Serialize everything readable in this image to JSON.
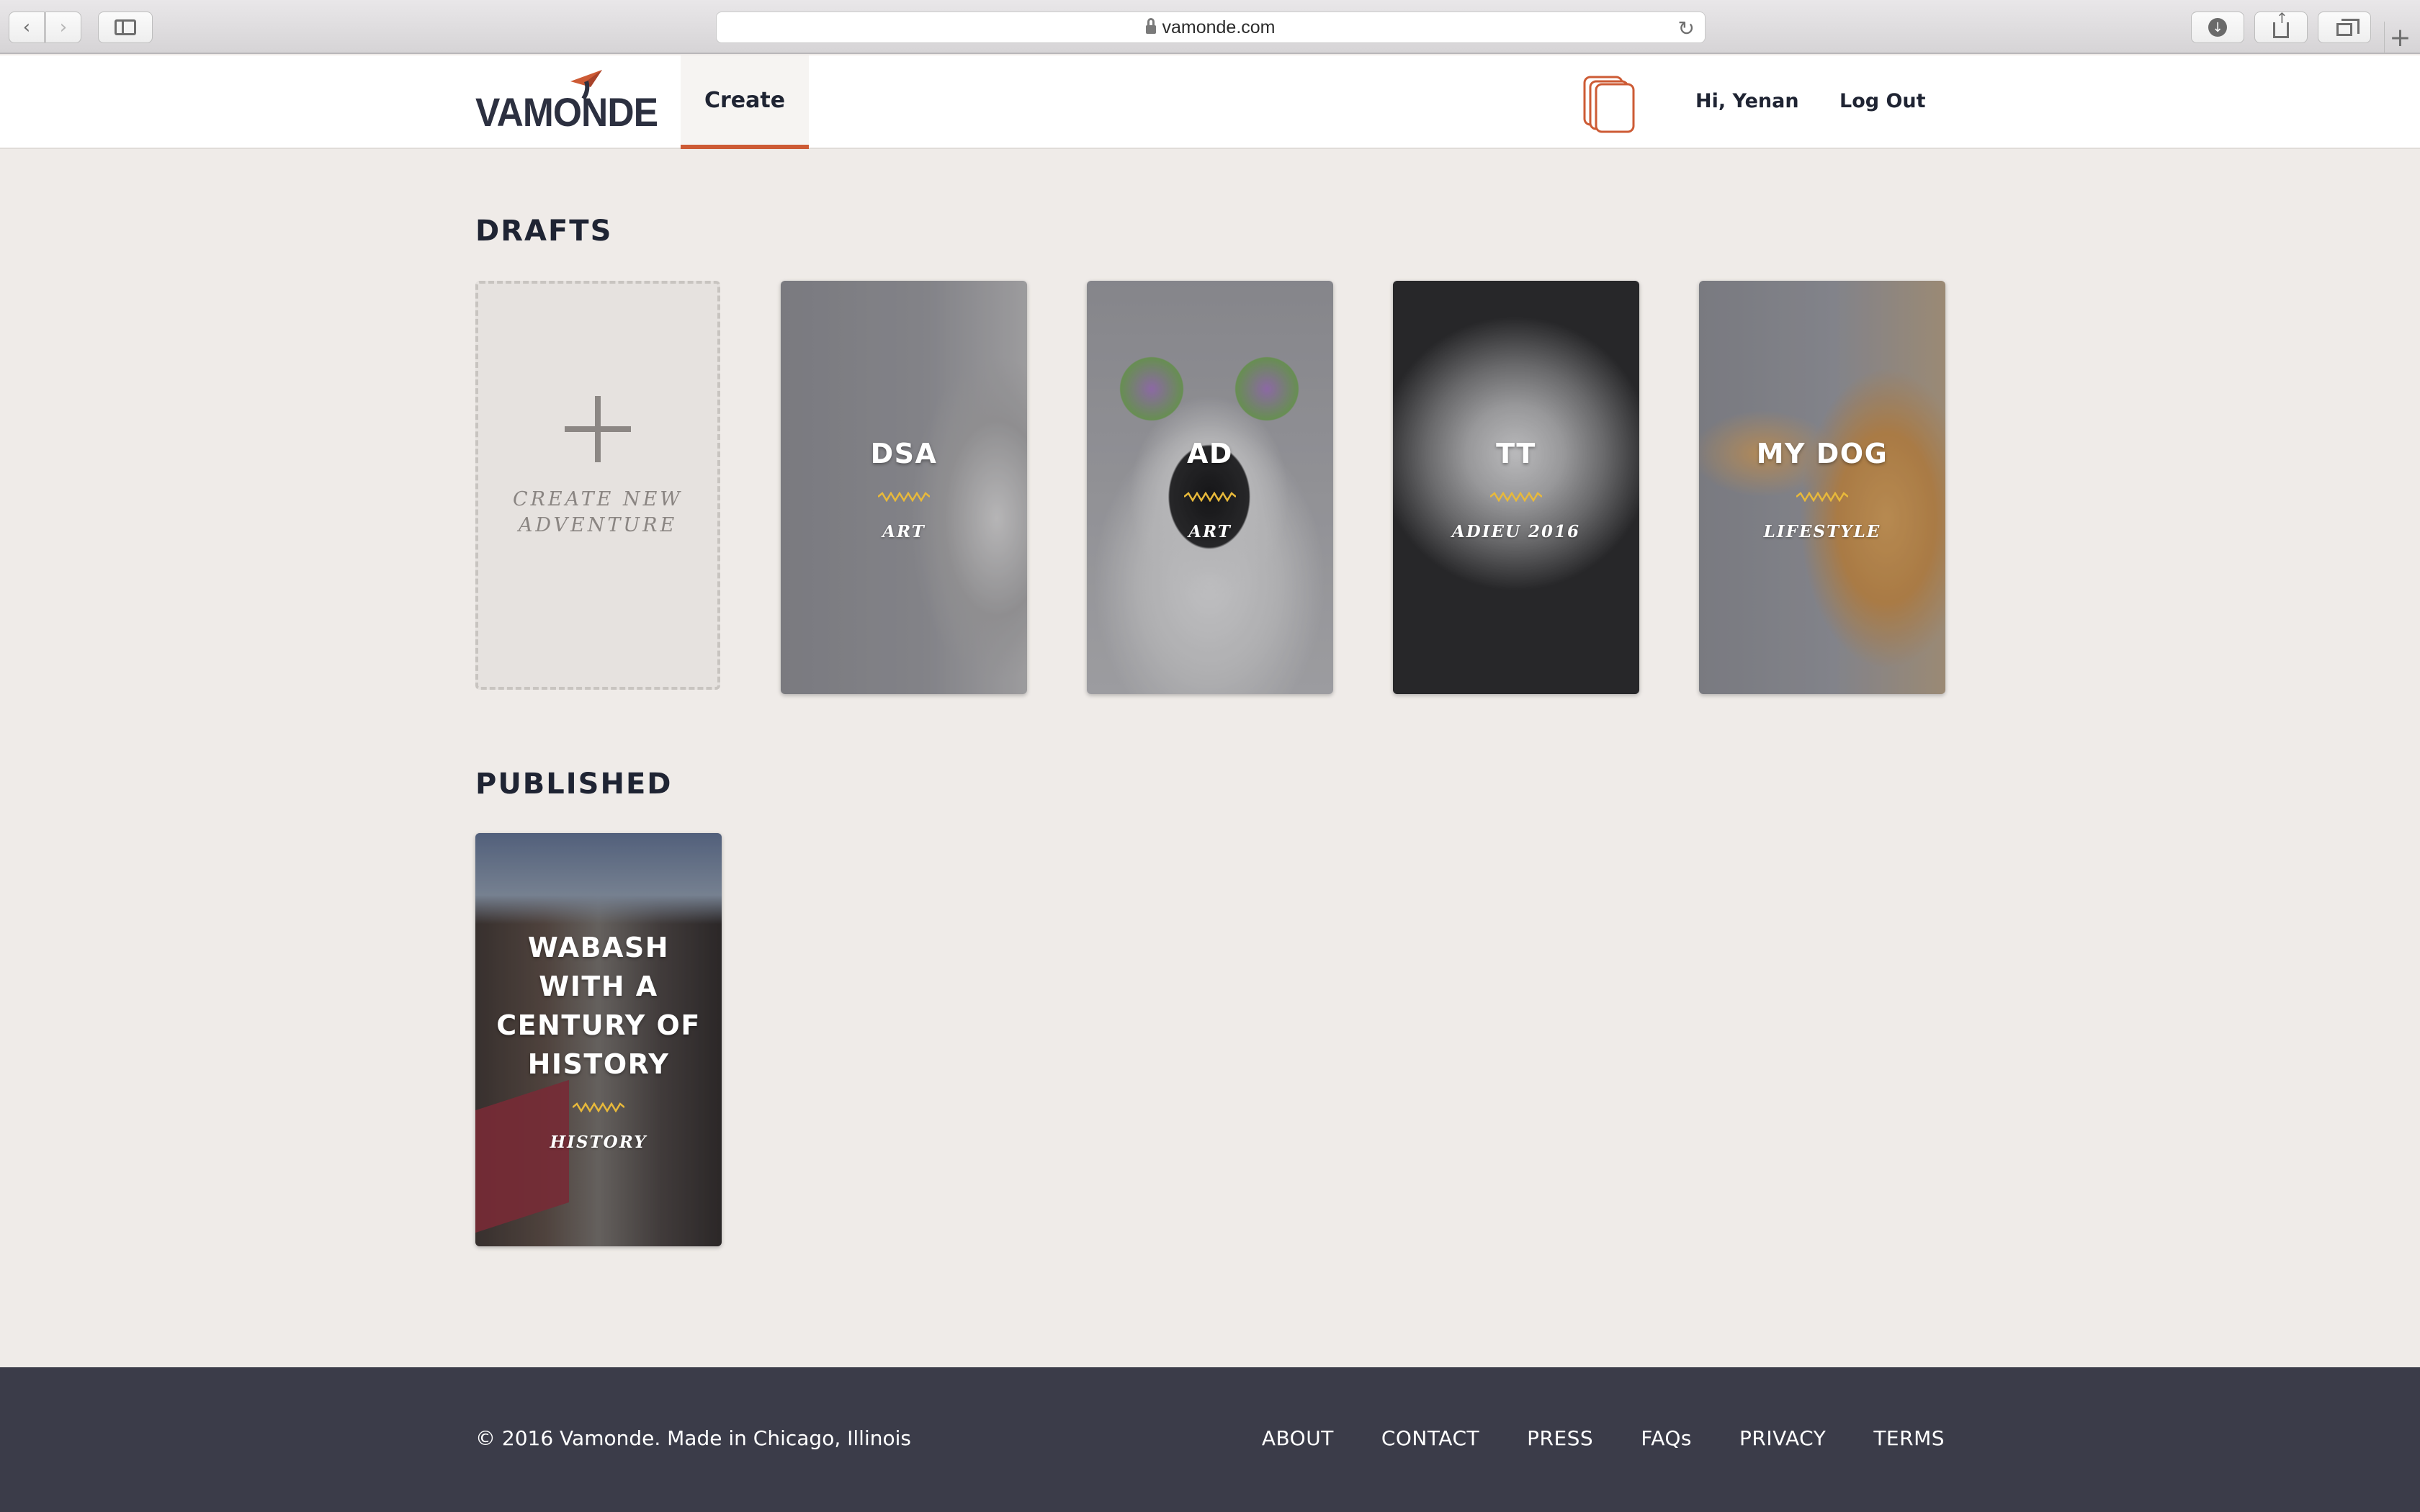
{
  "browser": {
    "url": "vamonde.com",
    "back_icon": "chevron-left-icon",
    "forward_icon": "chevron-right-icon",
    "reload_icon": "reload-icon"
  },
  "header": {
    "logo_text": "VAMONDE",
    "nav_create": "Create",
    "greeting": "Hi, Yenan",
    "logout": "Log Out",
    "accent_color": "#cd5b35"
  },
  "drafts": {
    "title": "DRAFTS",
    "create_label_line1": "CREATE NEW",
    "create_label_line2": "ADVENTURE",
    "cards": [
      {
        "title": "DSA",
        "category": "ART"
      },
      {
        "title": "AD",
        "category": "ART"
      },
      {
        "title": "TT",
        "category": "ADIEU 2016"
      },
      {
        "title": "MY DOG",
        "category": "LIFESTYLE"
      }
    ]
  },
  "published": {
    "title": "PUBLISHED",
    "cards": [
      {
        "title": "WABASH WITH A CENTURY OF HISTORY",
        "category": "HISTORY"
      }
    ]
  },
  "footer": {
    "copyright": "© 2016 Vamonde. Made in Chicago, Illinois",
    "links": [
      "ABOUT",
      "CONTACT",
      "PRESS",
      "FAQs",
      "PRIVACY",
      "TERMS"
    ],
    "background": "#3b3c49"
  }
}
